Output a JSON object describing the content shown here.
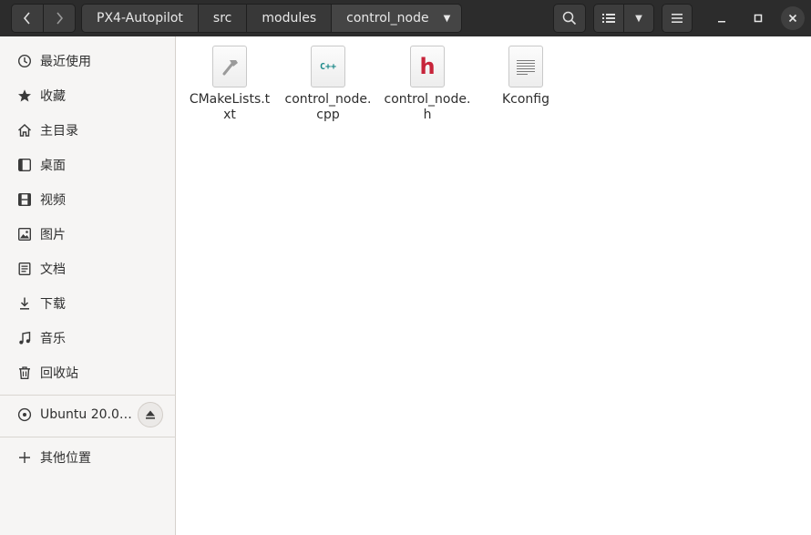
{
  "breadcrumbs": [
    "PX4-Autopilot",
    "src",
    "modules",
    "control_node"
  ],
  "sidebar": {
    "places": [
      {
        "label": "最近使用",
        "icon": "clock-icon"
      },
      {
        "label": "收藏",
        "icon": "star-icon"
      },
      {
        "label": "主目录",
        "icon": "home-icon"
      },
      {
        "label": "桌面",
        "icon": "desktop-icon"
      },
      {
        "label": "视频",
        "icon": "video-icon"
      },
      {
        "label": "图片",
        "icon": "picture-icon"
      },
      {
        "label": "文档",
        "icon": "document-icon"
      },
      {
        "label": "下载",
        "icon": "download-icon"
      },
      {
        "label": "音乐",
        "icon": "music-icon"
      },
      {
        "label": "回收站",
        "icon": "trash-icon"
      }
    ],
    "device": {
      "label": "Ubuntu 20.0…",
      "icon": "disc-icon"
    },
    "other": {
      "label": "其他位置",
      "icon": "plus-icon"
    }
  },
  "files": [
    {
      "name": "CMakeLists.txt",
      "icon": "cmake-text-file-icon",
      "icon_text": ""
    },
    {
      "name": "control_node.cpp",
      "icon": "cpp-file-icon",
      "icon_text": "C++"
    },
    {
      "name": "control_node.h",
      "icon": "header-file-icon",
      "icon_text": "h"
    },
    {
      "name": "Kconfig",
      "icon": "text-file-icon",
      "icon_text": ""
    }
  ],
  "colors": {
    "headerbar": "#2c2c2c",
    "sidebar": "#f6f5f4",
    "cpp_icon_text": "#1e8a8a",
    "h_icon_text": "#c7243a"
  }
}
